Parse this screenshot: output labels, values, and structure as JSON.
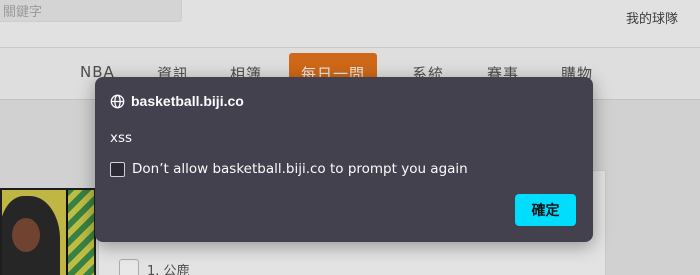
{
  "background": {
    "search_placeholder": "關鍵字",
    "my_team": "我的球隊",
    "nav": [
      {
        "label": "NBA"
      },
      {
        "label": "資訊"
      },
      {
        "label": "相簿"
      },
      {
        "label": "每日一問",
        "active": true
      },
      {
        "label": "系統"
      },
      {
        "label": "賽事"
      },
      {
        "label": "購物"
      }
    ],
    "option_label": "1. 公鹿"
  },
  "dialog": {
    "site_icon": "globe-icon",
    "origin": "basketball.biji.co",
    "message": "xss",
    "checkbox_checked": false,
    "checkbox_label": "Don’t allow basketball.biji.co to prompt you again",
    "ok_label": "確定"
  },
  "colors": {
    "dialog_bg": "#42414d",
    "ok_button": "#00ddff",
    "nav_active": "#e4731b"
  }
}
